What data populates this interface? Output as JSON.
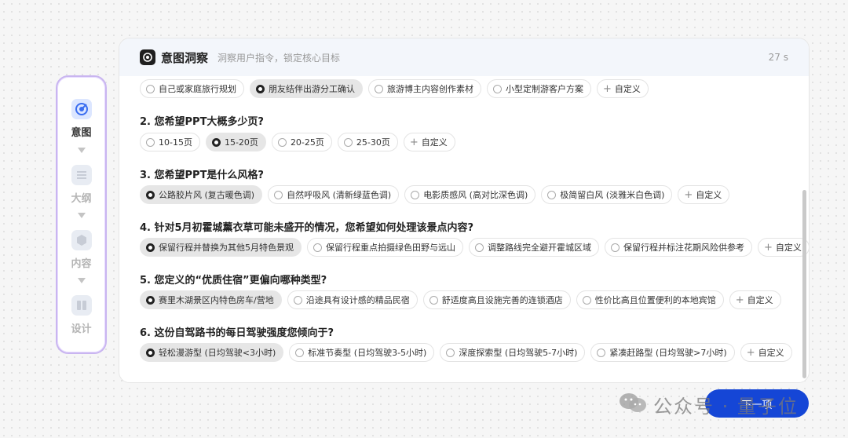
{
  "stepper": {
    "steps": [
      {
        "label": "意图",
        "icon": "target-icon",
        "active": true
      },
      {
        "label": "大纲",
        "icon": "list-icon",
        "active": false
      },
      {
        "label": "内容",
        "icon": "cube-icon",
        "active": false
      },
      {
        "label": "设计",
        "icon": "palette-icon",
        "active": false
      }
    ]
  },
  "card": {
    "title": "意图洞察",
    "subtitle": "洞察用户指令，锁定核心目标",
    "timer": "27 s"
  },
  "questions": [
    {
      "title": "",
      "options": [
        "自己或家庭旅行规划",
        "朋友结伴出游分工确认",
        "旅游博主内容创作素材",
        "小型定制游客户方案"
      ],
      "selected": 1,
      "custom": "自定义"
    },
    {
      "title": "2. 您希望PPT大概多少页?",
      "options": [
        "10-15页",
        "15-20页",
        "20-25页",
        "25-30页"
      ],
      "selected": 1,
      "custom": "自定义"
    },
    {
      "title": "3. 您希望PPT是什么风格?",
      "options": [
        "公路胶片风 (复古暖色调)",
        "自然呼吸风 (清新绿蓝色调)",
        "电影质感风 (高对比深色调)",
        "极简留白风 (淡雅米白色调)"
      ],
      "selected": 0,
      "custom": "自定义"
    },
    {
      "title": "4. 针对5月初霍城薰衣草可能未盛开的情况，您希望如何处理该景点内容?",
      "options": [
        "保留行程并替换为其他5月特色景观",
        "保留行程重点拍摄绿色田野与远山",
        "调整路线完全避开霍城区域",
        "保留行程并标注花期风险供参考"
      ],
      "selected": 0,
      "custom": "自定义"
    },
    {
      "title": "5. 您定义的“优质住宿”更偏向哪种类型?",
      "options": [
        "赛里木湖景区内特色房车/营地",
        "沿途具有设计感的精品民宿",
        "舒适度高且设施完善的连锁酒店",
        "性价比高且位置便利的本地宾馆"
      ],
      "selected": 0,
      "custom": "自定义"
    },
    {
      "title": "6. 这份自驾路书的每日驾驶强度您倾向于?",
      "options": [
        "轻松漫游型 (日均驾驶<3小时)",
        "标准节奏型 (日均驾驶3-5小时)",
        "深度探索型 (日均驾驶5-7小时)",
        "紧凑赶路型 (日均驾驶>7小时)"
      ],
      "selected": 0,
      "custom": "自定义"
    }
  ],
  "next_button": "下一项",
  "watermark": "公众号 · 量子位"
}
